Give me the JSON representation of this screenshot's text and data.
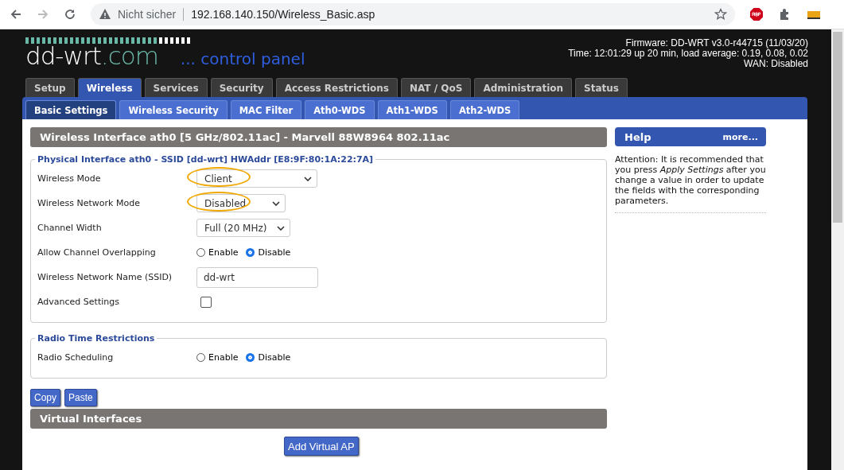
{
  "browser": {
    "security": "Nicht sicher",
    "url": "192.168.140.150/Wireless_Basic.asp"
  },
  "header": {
    "logo": "dd-wrt",
    "logo_suffix": ".com",
    "subtitle": "... control panel",
    "firmware": "Firmware: DD-WRT v3.0-r44715 (11/03/20)",
    "time": "Time: 12:01:29 up 20 min, load average: 0.19, 0.08, 0.02",
    "wan": "WAN: Disabled"
  },
  "tabs": [
    {
      "label": "Setup",
      "selected": false
    },
    {
      "label": "Wireless",
      "selected": true
    },
    {
      "label": "Services",
      "selected": false
    },
    {
      "label": "Security",
      "selected": false
    },
    {
      "label": "Access Restrictions",
      "selected": false
    },
    {
      "label": "NAT / QoS",
      "selected": false
    },
    {
      "label": "Administration",
      "selected": false
    },
    {
      "label": "Status",
      "selected": false
    }
  ],
  "subtabs": [
    {
      "label": "Basic Settings",
      "selected": true
    },
    {
      "label": "Wireless Security",
      "selected": false
    },
    {
      "label": "MAC Filter",
      "selected": false
    },
    {
      "label": "Ath0-WDS",
      "selected": false
    },
    {
      "label": "Ath1-WDS",
      "selected": false
    },
    {
      "label": "Ath2-WDS",
      "selected": false
    }
  ],
  "section_title": "Wireless Interface ath0 [5 GHz/802.11ac] - Marvell 88W8964 802.11ac",
  "fieldsets": [
    {
      "legend": "Physical Interface ath0 - SSID [dd-wrt] HWAddr [E8:9F:80:1A:22:7A]",
      "fields": [
        {
          "kind": "select",
          "label": "Wireless Mode",
          "value": "Client",
          "highlighted": true
        },
        {
          "kind": "select",
          "label": "Wireless Network Mode",
          "value": "Disabled",
          "highlighted": true
        },
        {
          "kind": "select",
          "label": "Channel Width",
          "value": "Full (20 MHz)",
          "highlighted": false
        },
        {
          "kind": "radio",
          "label": "Allow Channel Overlapping",
          "options": [
            {
              "label": "Enable",
              "selected": false
            },
            {
              "label": "Disable",
              "selected": true
            }
          ]
        },
        {
          "kind": "text",
          "label": "Wireless Network Name (SSID)",
          "value": "dd-wrt"
        },
        {
          "kind": "checkbox",
          "label": "Advanced Settings",
          "checked": false
        }
      ]
    },
    {
      "legend": "Radio Time Restrictions",
      "fields": [
        {
          "kind": "radio",
          "label": "Radio Scheduling",
          "options": [
            {
              "label": "Enable",
              "selected": false
            },
            {
              "label": "Disable",
              "selected": true
            }
          ]
        }
      ]
    }
  ],
  "buttons": [
    "Copy",
    "Paste"
  ],
  "virtual_title": "Virtual Interfaces",
  "add_button": "Add Virtual AP",
  "help": {
    "title": "Help",
    "more": "more...",
    "text": "Attention: It is recommended that you press *Apply Settings* after you change a value in order to update the fields with the corresponding parameters."
  }
}
